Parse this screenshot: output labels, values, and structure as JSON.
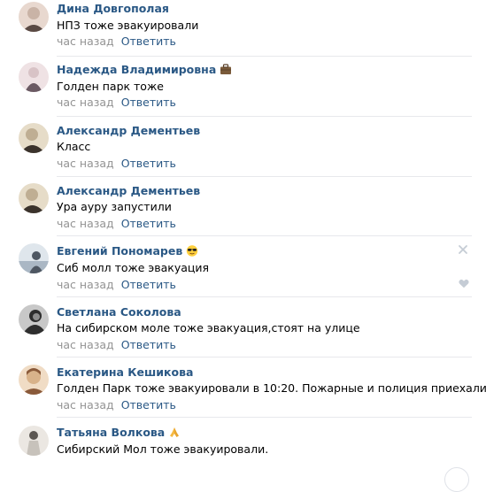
{
  "comments": [
    {
      "author": "Дина Довгополая",
      "text": "НПЗ тоже эвакуировали",
      "time": "час назад",
      "reply": "Ответить",
      "emoji": null,
      "avatar_colors": [
        "#c9b3a6",
        "#5a4a44",
        "#e8d8cf"
      ]
    },
    {
      "author": "Надежда Владимировна",
      "text": "Голден парк тоже",
      "time": "час назад",
      "reply": "Ответить",
      "emoji": "briefcase-emoji",
      "avatar_colors": [
        "#d8c3c6",
        "#6b5a63",
        "#efe2e4"
      ]
    },
    {
      "author": "Александр Дементьев",
      "text": "Класс",
      "time": "час назад",
      "reply": "Ответить",
      "emoji": null,
      "avatar_colors": [
        "#bfae93",
        "#3b332c",
        "#e6dcc8"
      ]
    },
    {
      "author": "Александр Дементьев",
      "text": "Ура ауру запустили",
      "time": "час назад",
      "reply": "Ответить",
      "emoji": null,
      "avatar_colors": [
        "#bfae93",
        "#3b332c",
        "#e6dcc8"
      ]
    },
    {
      "author": "Евгений Пономарев",
      "text": "Сиб молл тоже эвакуация",
      "time": "час назад",
      "reply": "Ответить",
      "emoji": "sunglasses-emoji",
      "avatar_colors": [
        "#aab7c4",
        "#4e5762",
        "#dfe6ec"
      ]
    },
    {
      "author": "Светлана Соколова",
      "text": "На сибирском моле тоже эвакуация,стоят на улице",
      "time": "час назад",
      "reply": "Ответить",
      "emoji": null,
      "avatar_colors": [
        "#8d8d8d",
        "#2e2e2e",
        "#c8c8c8"
      ]
    },
    {
      "author": "Екатерина Кешикова",
      "text": "Голден Парк тоже эвакуировали в 10:20. Пожарные и полиция приехали.",
      "time": "час назад",
      "reply": "Ответить",
      "emoji": null,
      "avatar_colors": [
        "#d8b28a",
        "#8a5a3a",
        "#f0dcc5"
      ]
    },
    {
      "author": "Татьяна Волкова",
      "text": "Сибирский Мол тоже эвакуировали.",
      "time": "",
      "reply": "",
      "emoji": "praying-hands-emoji",
      "avatar_colors": [
        "#c7c2bb",
        "#5c5752",
        "#ebe7e2"
      ]
    }
  ],
  "colors": {
    "link": "#2a5885",
    "meta": "#939393",
    "divider": "#e7e8ec",
    "icon": "#c5ccd5"
  },
  "icons": {
    "delete": "close-icon",
    "like": "heart-icon"
  }
}
